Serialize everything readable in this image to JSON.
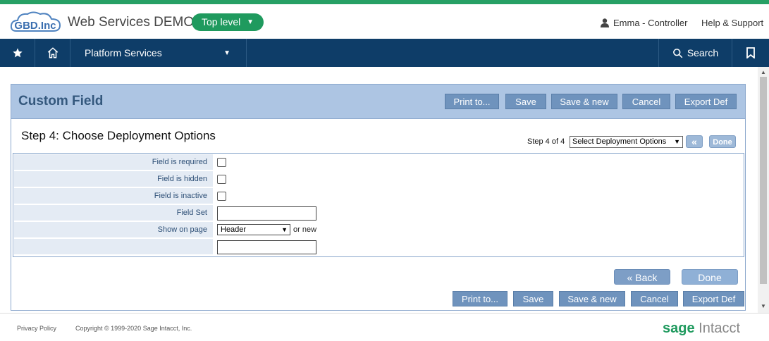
{
  "header": {
    "logo_text": "GBD.Inc",
    "company_name": "Web Services DEMO",
    "level_label": "Top level",
    "user_label": "Emma - Controller",
    "help_label": "Help & Support"
  },
  "nav": {
    "platform_label": "Platform Services",
    "search_label": "Search"
  },
  "page": {
    "title": "Custom Field",
    "top_buttons": [
      "Print to...",
      "Save",
      "Save & new",
      "Cancel",
      "Export Def"
    ],
    "step_title": "Step 4: Choose Deployment Options",
    "step_indicator": "Step 4 of 4",
    "step_select_value": "Select Deployment Options",
    "prev_icon": "«",
    "done_small": "Done"
  },
  "form": {
    "rows": [
      {
        "label": "Field is required"
      },
      {
        "label": "Field is hidden"
      },
      {
        "label": "Field is inactive"
      },
      {
        "label": "Field Set"
      },
      {
        "label": "Show on page"
      },
      {
        "label": ""
      }
    ],
    "show_on_page_value": "Header",
    "or_new": "or new"
  },
  "bottom": {
    "back_label": "« Back",
    "done_label": "Done",
    "buttons": [
      "Print to...",
      "Save",
      "Save & new",
      "Cancel",
      "Export Def"
    ]
  },
  "footer": {
    "privacy": "Privacy Policy",
    "copyright": "Copyright © 1999-2020 Sage Intacct, Inc.",
    "brand_sage": "sage",
    "brand_intacct": "Intacct"
  },
  "colors": {
    "accent_green": "#1f9a5e",
    "nav_blue": "#0e3d68",
    "title_bar": "#adc5e3",
    "button_blue": "#6f93bd"
  }
}
